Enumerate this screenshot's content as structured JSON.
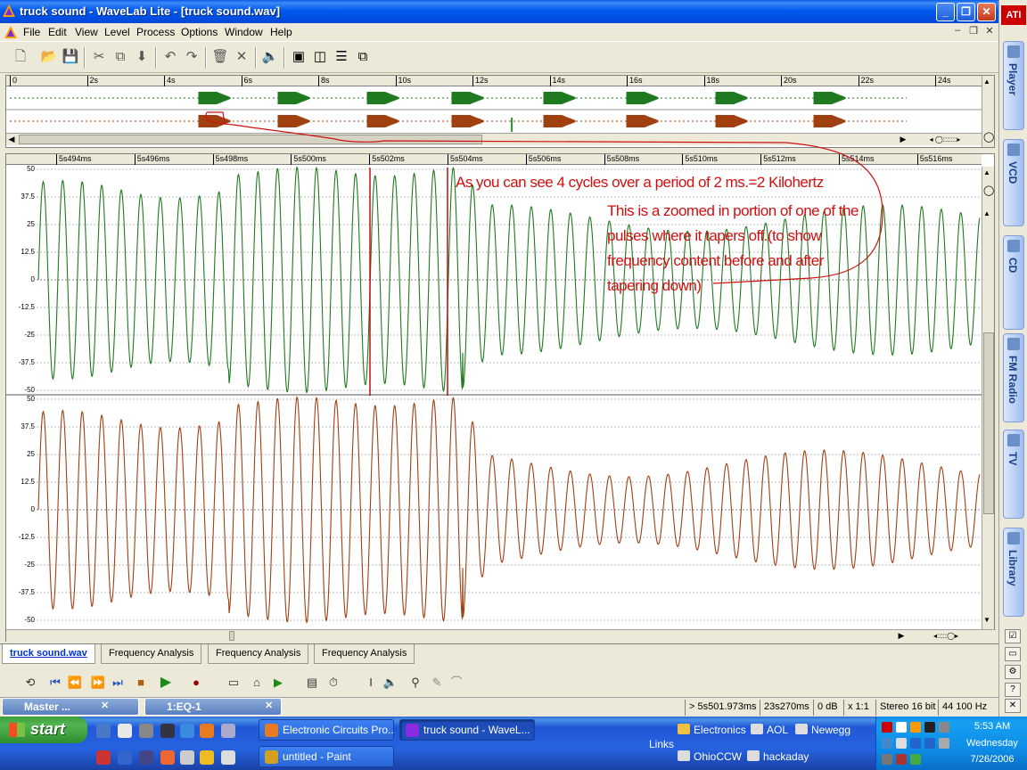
{
  "window": {
    "title": "truck sound - WaveLab Lite - [truck sound.wav]",
    "controls": {
      "minimize": "_",
      "restore": "❐",
      "close": "✕"
    }
  },
  "menu": [
    "File",
    "Edit",
    "View",
    "Level",
    "Process",
    "Options",
    "Window",
    "Help"
  ],
  "mdi_controls": [
    "–",
    "❐",
    "✕"
  ],
  "toolbar": [
    {
      "icon": "new-icon",
      "glyph": "🗋"
    },
    {
      "icon": "open-icon",
      "glyph": "📂"
    },
    {
      "icon": "save-icon",
      "glyph": "💾"
    },
    {
      "icon": "cut-icon",
      "glyph": "✂"
    },
    {
      "icon": "copy-icon",
      "glyph": "⧉"
    },
    {
      "icon": "paste-icon",
      "glyph": "⬇"
    },
    {
      "icon": "undo-icon",
      "glyph": "↶"
    },
    {
      "icon": "redo-icon",
      "glyph": "↷"
    },
    {
      "icon": "trash-icon",
      "glyph": "🗑"
    },
    {
      "icon": "delete-icon",
      "glyph": "✕"
    },
    {
      "icon": "speaker-icon",
      "glyph": "🔈"
    },
    {
      "icon": "window-icon",
      "glyph": "▣"
    },
    {
      "icon": "tile-vertical-icon",
      "glyph": "◫"
    },
    {
      "icon": "tile-horizontal-icon",
      "glyph": "☰"
    },
    {
      "icon": "arrange-icon",
      "glyph": "⧉"
    }
  ],
  "overview_ruler": [
    "0",
    "2s",
    "4s",
    "6s",
    "8s",
    "10s",
    "12s",
    "14s",
    "16s",
    "18s",
    "20s",
    "22s",
    "24s"
  ],
  "main_ruler": [
    "5s494ms",
    "5s496ms",
    "5s498ms",
    "5s500ms",
    "5s502ms",
    "5s504ms",
    "5s506ms",
    "5s508ms",
    "5s510ms",
    "5s512ms",
    "5s514ms",
    "5s516ms"
  ],
  "y_axis": [
    "50",
    "37.5",
    "25",
    "12.5",
    "0",
    "-12.5",
    "-25",
    "-37.5",
    "-50"
  ],
  "annotations": {
    "line1": "As you can see 4 cycles over a period of 2 ms.=2 Kilohertz",
    "line2": "This is a zoomed in portion of one of the",
    "line3": "pulses where it tapers off.(to show",
    "line4": "frequency content before and after",
    "line5": "tapering down)"
  },
  "colors": {
    "left_channel": "#1f7a1f",
    "right_channel": "#a04010",
    "annotation": "#d01010",
    "taskbar": "#2457d0"
  },
  "file_tabs": [
    "truck sound.wav",
    "Frequency Analysis",
    "Frequency Analysis",
    "Frequency Analysis"
  ],
  "status": {
    "cursor": "> 5s501.973ms",
    "length": "23s270ms",
    "level": "0 dB",
    "zoom": "x 1:1",
    "format": "Stereo 16 bit",
    "rate": "44 100 Hz"
  },
  "minimized_windows": [
    {
      "label": "Master ..."
    },
    {
      "label": "1:EQ-1"
    }
  ],
  "sidebar_tabs": [
    "Player",
    "VCD",
    "CD",
    "FM Radio",
    "TV",
    "Library"
  ],
  "sidebar_brand": "ATI",
  "taskbar": {
    "start": "start",
    "tasks": [
      {
        "label": "Electronic Circuits Pro...",
        "color": "#e87a20"
      },
      {
        "label": "truck sound - WaveL...",
        "color": "#8a2be2",
        "active": true
      },
      {
        "label": "untitled - Paint",
        "color": "#d4a020"
      }
    ],
    "links_label": "Links",
    "links": [
      "Electronics",
      "AOL",
      "Newegg",
      "OhioCCW",
      "hackaday"
    ],
    "clock": {
      "time": "5:53 AM",
      "day": "Wednesday",
      "date": "7/26/2006"
    }
  }
}
